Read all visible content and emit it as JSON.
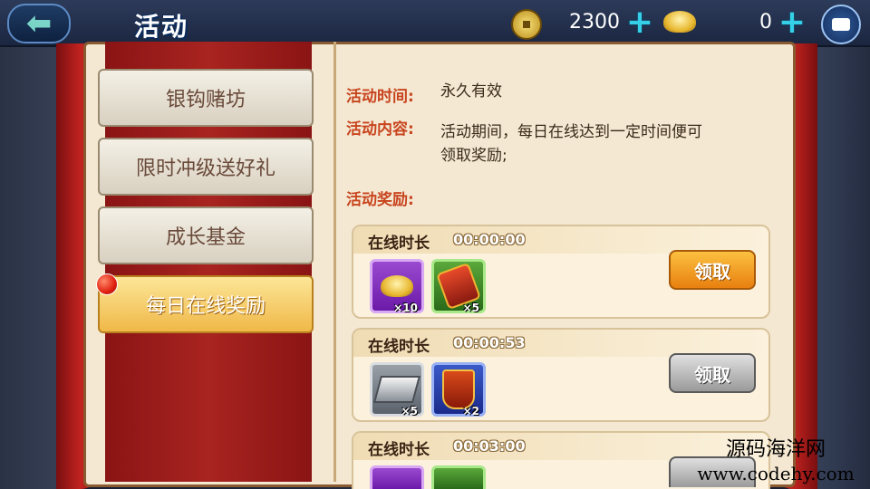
{
  "header": {
    "title": "活动",
    "copper_coins": "2300",
    "gold_ingots": "0"
  },
  "tabs": [
    {
      "label": "银钩赌坊",
      "active": false
    },
    {
      "label": "限时冲级送好礼",
      "active": false
    },
    {
      "label": "成长基金",
      "active": false
    },
    {
      "label": "每日在线奖励",
      "active": true
    }
  ],
  "activity": {
    "time_label": "活动时间:",
    "time_value": "永久有效",
    "content_label": "活动内容:",
    "content_value_line1": "活动期间，每日在线达到一定时间便可",
    "content_value_line2": "领取奖励;",
    "reward_label": "活动奖励:"
  },
  "rewards": [
    {
      "label": "在线时长",
      "time": "00:00:00",
      "items": [
        {
          "icon": "gold-ingot-icon",
          "count": "×10",
          "rarity": "purple"
        },
        {
          "icon": "red-scroll-icon",
          "count": "×5",
          "rarity": "green"
        }
      ],
      "button": "领取",
      "button_state": "active"
    },
    {
      "label": "在线时长",
      "time": "00:00:53",
      "items": [
        {
          "icon": "silver-bar-icon",
          "count": "×5",
          "rarity": "grey"
        },
        {
          "icon": "token-icon",
          "count": "×2",
          "rarity": "blue"
        }
      ],
      "button": "领取",
      "button_state": "disabled"
    },
    {
      "label": "在线时长",
      "time": "00:03:00",
      "button_state": "disabled"
    }
  ],
  "watermark": {
    "line1": "源码海洋网",
    "line2": "www.codehy.com"
  },
  "colors": {
    "accent_label": "#c8441e",
    "active_tab": "#f0b848",
    "claim_button": "#e88010"
  }
}
